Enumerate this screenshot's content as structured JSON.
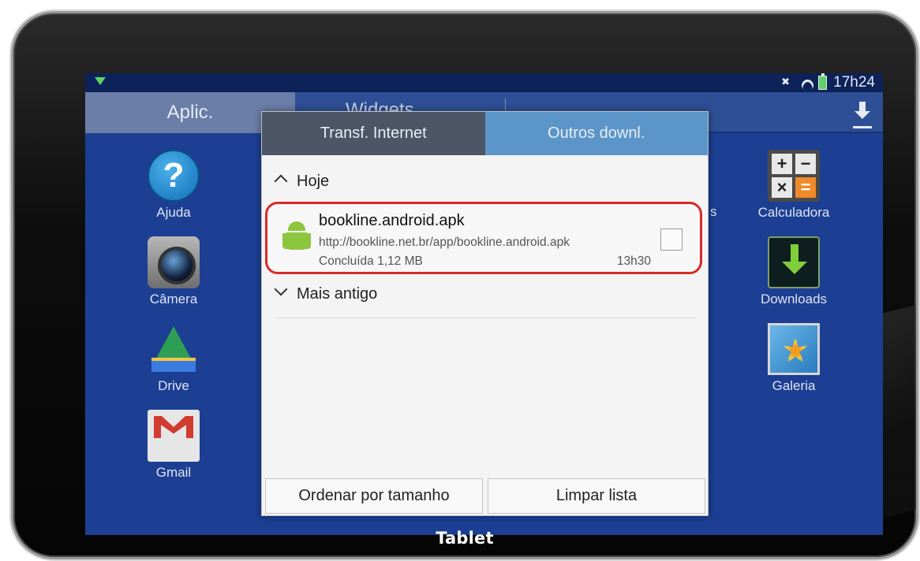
{
  "status_bar": {
    "time": "17h24",
    "icons": [
      "notification-arrow-icon",
      "mute-icon",
      "wifi-icon",
      "battery-charging-icon"
    ]
  },
  "launcher": {
    "tabs": [
      {
        "label": "Aplic.",
        "active": true
      },
      {
        "label": "Widgets",
        "active": false
      }
    ],
    "apps_left": [
      {
        "label": "Ajuda",
        "icon": "help-icon"
      },
      {
        "label": "Câmera",
        "icon": "camera-icon"
      },
      {
        "label": "Drive",
        "icon": "drive-icon"
      },
      {
        "label": "Gmail",
        "icon": "gmail-icon"
      }
    ],
    "apps_right": [
      {
        "label": "Calculadora",
        "icon": "calculator-icon"
      },
      {
        "label": "Downloads",
        "icon": "downloads-icon"
      },
      {
        "label": "Galeria",
        "icon": "gallery-icon"
      }
    ],
    "partial_label": "s"
  },
  "dialog": {
    "tabs": [
      {
        "label": "Transf. Internet",
        "active": false
      },
      {
        "label": "Outros downl.",
        "active": true
      }
    ],
    "sections": {
      "today": "Hoje",
      "older": "Mais antigo"
    },
    "item": {
      "filename": "bookline.android.apk",
      "url": "http://bookline.net.br/app/bookline.android.apk",
      "status": "Concluída",
      "size": "1,12 MB",
      "time": "13h30",
      "checked": false
    },
    "buttons": {
      "sort": "Ordenar por tamanho",
      "clear": "Limpar lista"
    }
  },
  "colors": {
    "screen_bg": "#1c3f93",
    "active_dialog_tab": "#5c96c8",
    "highlight_border": "#d72a2a"
  },
  "caption": "Tablet"
}
